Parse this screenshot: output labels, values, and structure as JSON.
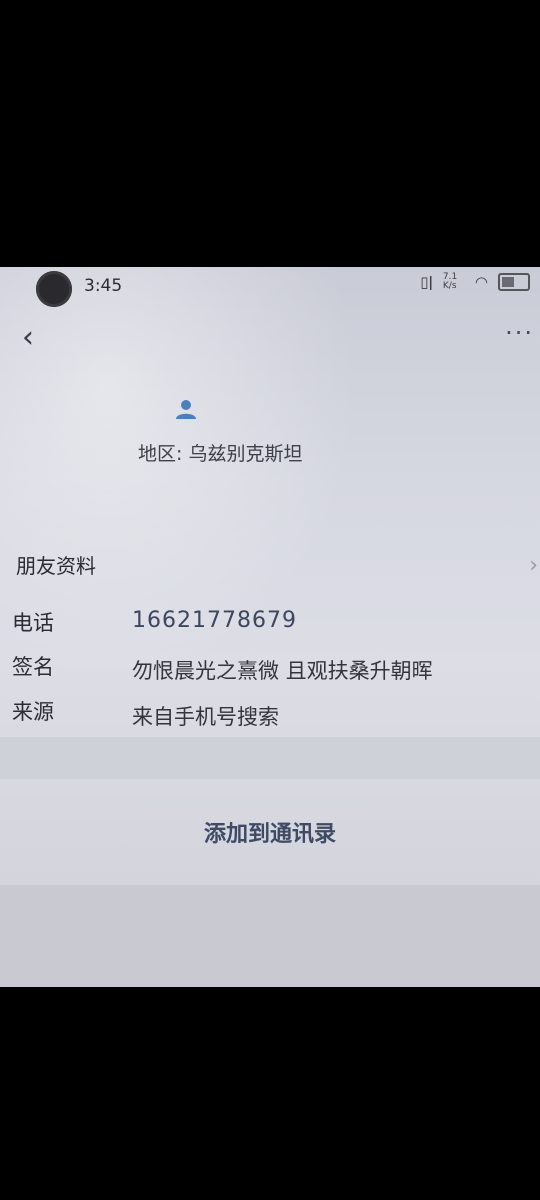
{
  "status_bar": {
    "time": "3:45",
    "network_speed": "7.1 K/s"
  },
  "nav": {
    "back_icon": "chevron-left-icon",
    "more_label": "···"
  },
  "profile": {
    "region": "地区: 乌兹别克斯坦"
  },
  "friend_info": {
    "section_title": "朋友资料",
    "rows": [
      {
        "label": "电话",
        "value": "16621778679"
      },
      {
        "label": "签名",
        "value": "勿恨晨光之熹微 且观扶桑升朝晖"
      },
      {
        "label": "来源",
        "value": "来自手机号搜索"
      }
    ]
  },
  "actions": {
    "add_to_contacts": "添加到通讯录"
  },
  "colors": {
    "accent_text": "#3e4a66",
    "avatar_blue": "#4a7fc0"
  }
}
